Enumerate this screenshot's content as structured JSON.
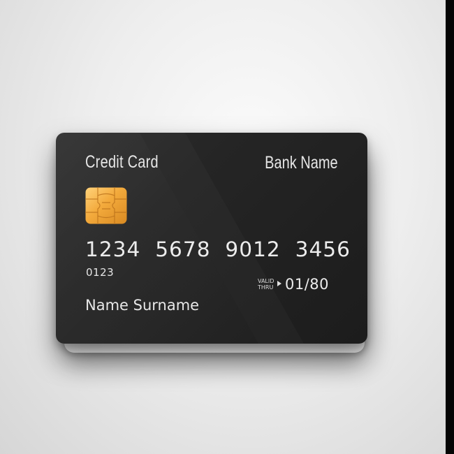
{
  "card": {
    "title": "Credit Card",
    "bank_name": "Bank Name",
    "number": "1234  5678  9012  3456",
    "sub_number": "0123",
    "valid_line1": "VALID",
    "valid_line2": "THRU",
    "expiry": "01/80",
    "cardholder": "Name Surname",
    "chip_icon": "emv-chip-icon",
    "card_color": "#252525",
    "chip_color": "#f0a940"
  }
}
